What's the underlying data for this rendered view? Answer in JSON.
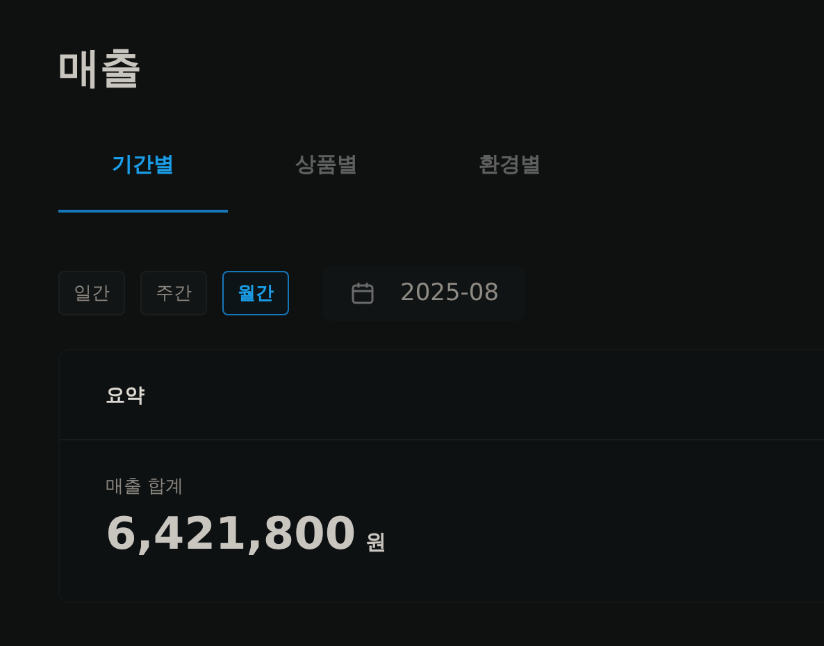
{
  "page": {
    "title": "매출"
  },
  "tabs": [
    {
      "label": "기간별",
      "selected": true
    },
    {
      "label": "상품별",
      "selected": false
    },
    {
      "label": "환경별",
      "selected": false
    }
  ],
  "periods": [
    {
      "label": "일간",
      "selected": false
    },
    {
      "label": "주간",
      "selected": false
    },
    {
      "label": "월간",
      "selected": true
    }
  ],
  "date_field": {
    "value": "2025-08"
  },
  "summary": {
    "title": "요약",
    "label": "매출 합계",
    "amount": "6,421,800",
    "unit": "원"
  }
}
